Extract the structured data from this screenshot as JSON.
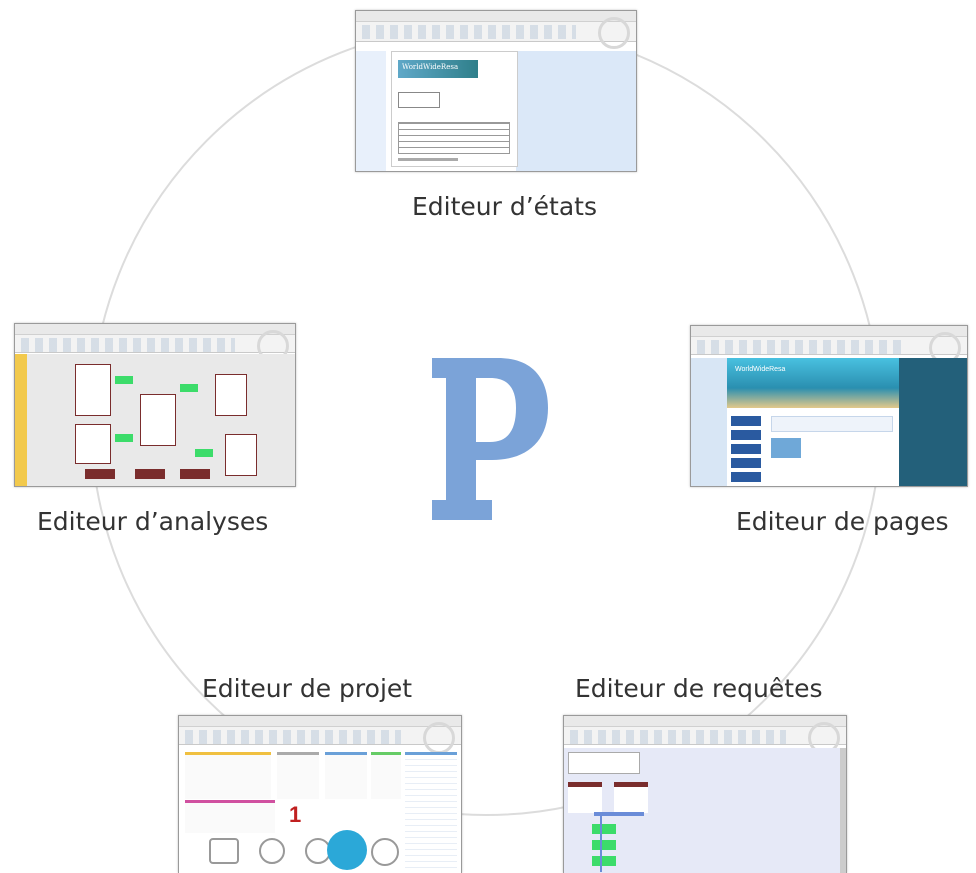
{
  "labels": {
    "etats": "Editeur d’états",
    "analyses": "Editeur d’analyses",
    "pages": "Editeur de pages",
    "projet": "Editeur de projet",
    "requetes": "Editeur de requêtes"
  },
  "center_logo": {
    "letter": "P",
    "color": "#7ba3d8"
  },
  "thumbnails": {
    "etats": {
      "logo_text": "WorldWideResa"
    },
    "pages": {
      "banner_text": "WorldWideResa"
    },
    "projet": {
      "counter": "1"
    }
  }
}
